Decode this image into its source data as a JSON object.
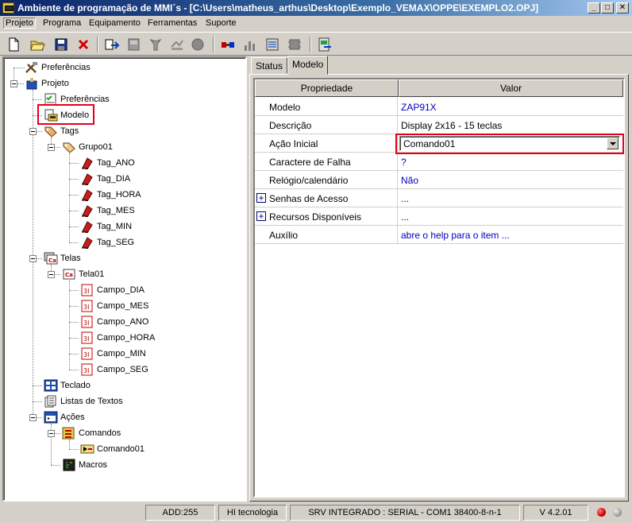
{
  "window": {
    "title": "Ambiente de programação de MMI´s - [C:\\Users\\matheus_arthus\\Desktop\\Exemplo_VEMAX\\OPPE\\EXEMPLO2.OPJ]",
    "minimize": "_",
    "maximize": "□",
    "close": "✕"
  },
  "menu": {
    "items": [
      "Projeto",
      "Programa",
      "Equipamento",
      "Ferramentas",
      "Suporte"
    ],
    "active": "Projeto"
  },
  "toolbar": {
    "buttons": [
      "new-file-icon",
      "open-folder-icon",
      "save-icon",
      "delete-icon",
      "transfer-icon",
      "device-icon",
      "grey-tool-icon",
      "grey-filter-icon",
      "grey-circle-icon",
      "connector-icon",
      "chart-icon",
      "scale-icon",
      "grey-chip-icon",
      "export-icon"
    ]
  },
  "tree": {
    "root_preferences": "Preferências",
    "projeto": "Projeto",
    "preferencias": "Preferências",
    "modelo": "Modelo",
    "tags": "Tags",
    "grupo01": "Grupo01",
    "tag_items": [
      "Tag_ANO",
      "Tag_DIA",
      "Tag_HORA",
      "Tag_MES",
      "Tag_MIN",
      "Tag_SEG"
    ],
    "telas": "Telas",
    "tela01": "Tela01",
    "campo_items": [
      "Campo_DIA",
      "Campo_MES",
      "Campo_ANO",
      "Campo_HORA",
      "Campo_MIN",
      "Campo_SEG"
    ],
    "teclado": "Teclado",
    "listas": "Listas de Textos",
    "acoes": "Ações",
    "comandos": "Comandos",
    "comando01": "Comando01",
    "macros": "Macros",
    "tela_icon_text": "Ca",
    "campo_icon_text": "3I"
  },
  "tabs": {
    "status": "Status",
    "modelo": "Modelo",
    "active": "Modelo"
  },
  "grid": {
    "header_prop": "Propriedade",
    "header_val": "Valor",
    "rows": [
      {
        "prop": "Modelo",
        "val": "ZAP91X"
      },
      {
        "prop": "Descrição",
        "val": "Display 2x16 - 15 teclas"
      },
      {
        "prop": "Ação Inicial",
        "val": "Comando01"
      },
      {
        "prop": "Caractere de Falha",
        "val": "?"
      },
      {
        "prop": "Relógio/calendário",
        "val": "Não"
      },
      {
        "prop": "Senhas de Acesso",
        "val": "..."
      },
      {
        "prop": "Recursos Disponíveis",
        "val": "..."
      },
      {
        "prop": "Auxílio",
        "val": "abre o help para o item ..."
      }
    ]
  },
  "statusbar": {
    "addr": "ADD:255",
    "company": "HI tecnologia",
    "connection": "SRV INTEGRADO : SERIAL - COM1 38400-8-n-1",
    "version": "V 4.2.01"
  },
  "colors": {
    "highlight": "#e4001b",
    "value_blue": "#0000c0",
    "led_red": "#cc0000",
    "led_grey": "#a0a0a0"
  }
}
